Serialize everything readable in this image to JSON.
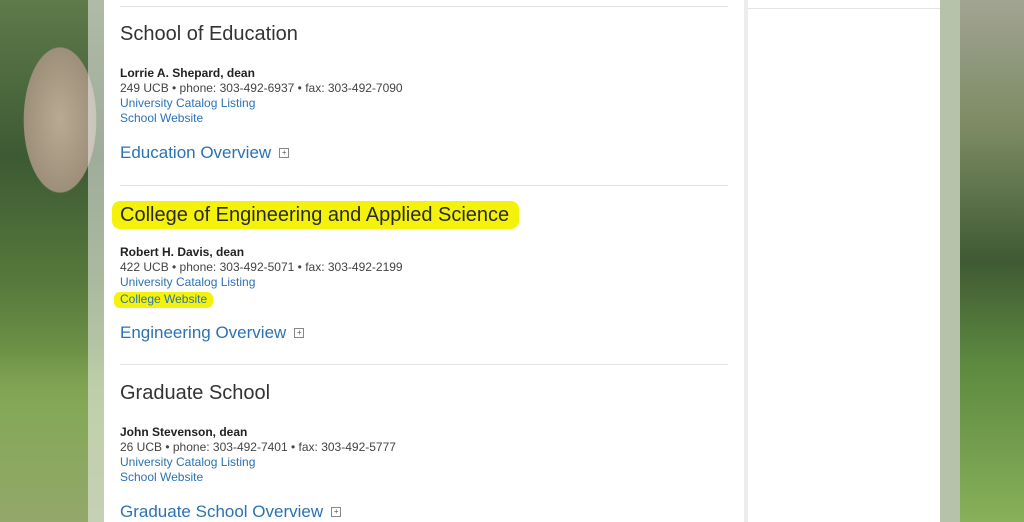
{
  "sections": [
    {
      "title": "School of Education",
      "dean": "Lorrie A. Shepard, dean",
      "info": "249 UCB • phone: 303-492-6937 • fax: 303-492-7090",
      "catalog_link": "University Catalog Listing",
      "website_link": "School Website",
      "overview_link": "Education Overview",
      "expand_symbol": "+"
    },
    {
      "title": "College of Engineering and Applied Science",
      "dean": "Robert H. Davis, dean",
      "info": "422 UCB • phone: 303-492-5071 • fax: 303-492-2199",
      "catalog_link": "University Catalog Listing",
      "website_link": "College Website",
      "overview_link": "Engineering Overview",
      "expand_symbol": "+"
    },
    {
      "title": "Graduate School",
      "dean": "John Stevenson, dean",
      "info": "26 UCB • phone: 303-492-7401 • fax: 303-492-5777",
      "catalog_link": "University Catalog Listing",
      "website_link": "School Website",
      "overview_link": "Graduate School Overview",
      "expand_symbol": "+"
    }
  ],
  "colors": {
    "link": "#2a72b5",
    "highlight": "#f4f20a",
    "title_text": "#333333"
  }
}
